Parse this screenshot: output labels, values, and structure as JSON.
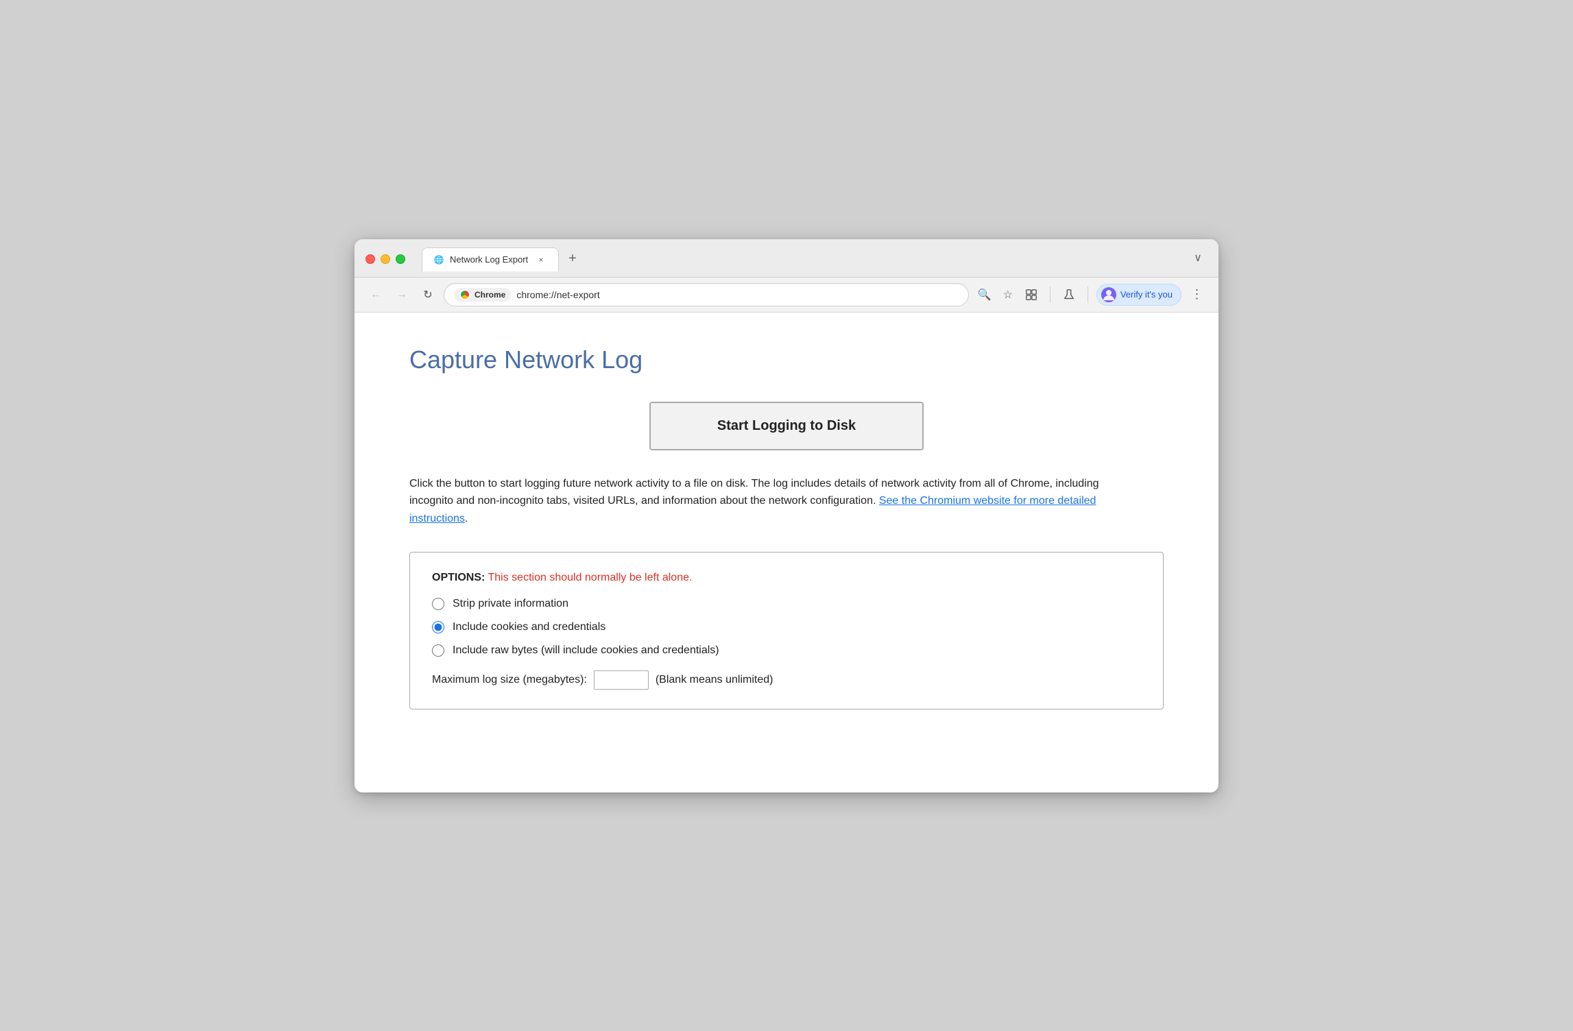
{
  "window": {
    "title": "Network Log Export"
  },
  "tab": {
    "favicon": "🌐",
    "title": "Network Log Export",
    "close_icon": "×"
  },
  "new_tab_icon": "+",
  "expand_icon": "∨",
  "nav": {
    "back_icon": "←",
    "forward_icon": "→",
    "reload_icon": "↻",
    "chrome_label": "Chrome",
    "url": "chrome://net-export",
    "search_icon": "🔍",
    "star_icon": "☆",
    "extension_icon": "⬚",
    "lab_icon": "⚗",
    "verify_label": "Verify it's you",
    "menu_icon": "⋮"
  },
  "page": {
    "title": "Capture Network Log",
    "start_button": "Start Logging to Disk",
    "description_part1": "Click the button to start logging future network activity to a file on disk. The log includes details of network activity from all of Chrome, including incognito and non-incognito tabs, visited URLs, and information about the network configuration. ",
    "description_link": "See the Chromium website for more detailed instructions",
    "description_end": ".",
    "options": {
      "header_label": "OPTIONS:",
      "header_warning": " This section should normally be left alone.",
      "radio_items": [
        {
          "id": "strip",
          "label": "Strip private information",
          "checked": false
        },
        {
          "id": "cookies",
          "label": "Include cookies and credentials",
          "checked": true
        },
        {
          "id": "raw",
          "label": "Include raw bytes (will include cookies and credentials)",
          "checked": false
        }
      ],
      "max_size_label": "Maximum log size (megabytes):",
      "max_size_value": "",
      "max_size_hint": "(Blank means unlimited)"
    }
  }
}
